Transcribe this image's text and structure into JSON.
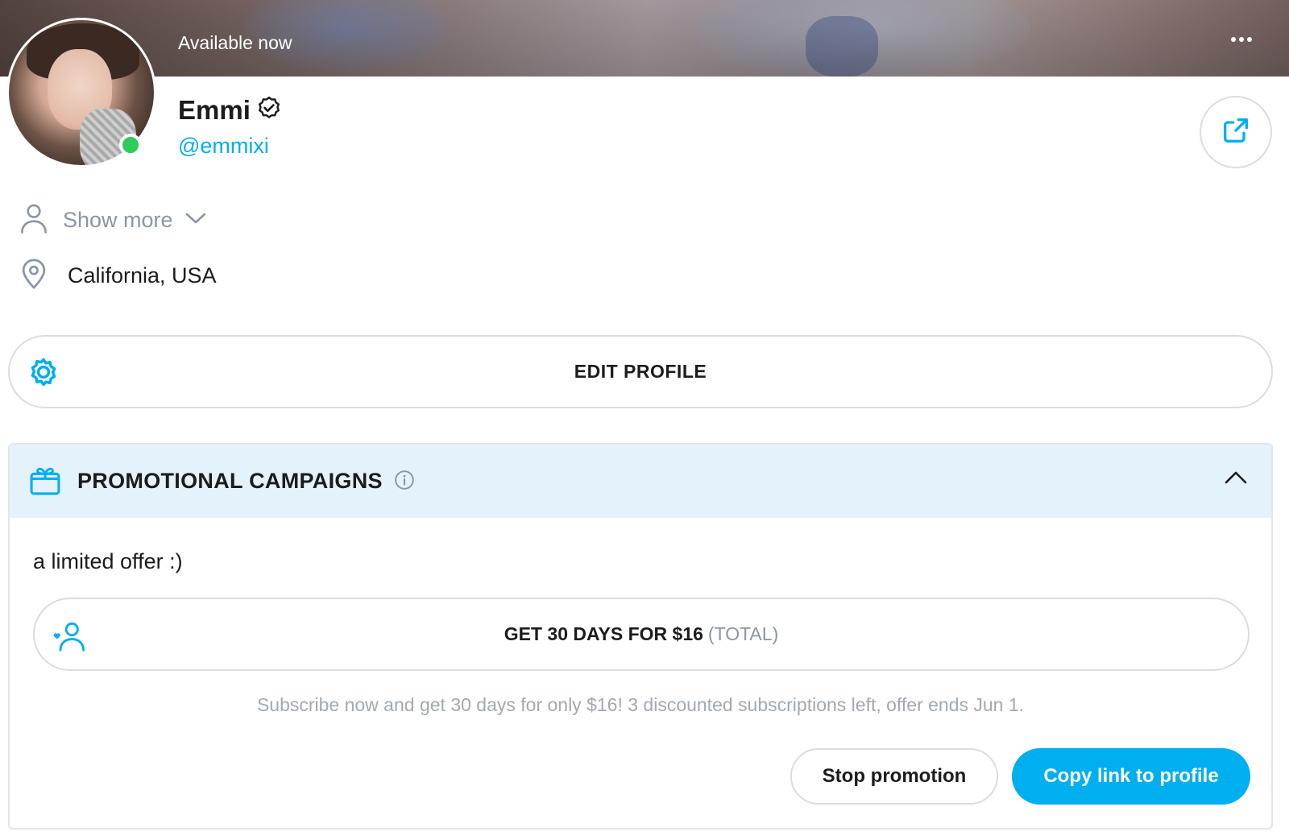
{
  "cover": {
    "status_text": "Available now"
  },
  "profile": {
    "name": "Emmi",
    "handle": "@emmixi",
    "verified": true,
    "online": true,
    "show_more_label": "Show more",
    "location": "California, USA",
    "edit_profile_label": "EDIT PROFILE"
  },
  "promotional_campaigns": {
    "title": "PROMOTIONAL CAMPAIGNS",
    "expanded": true,
    "description": "a limited offer :)",
    "offer": {
      "main_label": "GET 30 DAYS FOR $16",
      "suffix_label": "(TOTAL)"
    },
    "note": "Subscribe now and get 30 days for only $16! 3 discounted subscriptions left, offer ends Jun 1.",
    "stop_button_label": "Stop promotion",
    "copy_button_label": "Copy link to profile"
  },
  "icons": {
    "more": "more-dots-icon",
    "verified": "verified-badge-icon",
    "share": "share-icon",
    "user": "user-icon",
    "chevron_down": "chevron-down-icon",
    "location": "location-pin-icon",
    "gear": "gear-icon",
    "gift": "gift-icon",
    "info": "info-icon",
    "chevron_up": "chevron-up-icon",
    "user_heart": "user-heart-icon"
  },
  "colors": {
    "accent": "#00aff0",
    "online": "#2ecc5a",
    "muted_text": "#8a96a3",
    "promo_header_bg": "#e4f2fb",
    "border": "#d9dde2"
  }
}
